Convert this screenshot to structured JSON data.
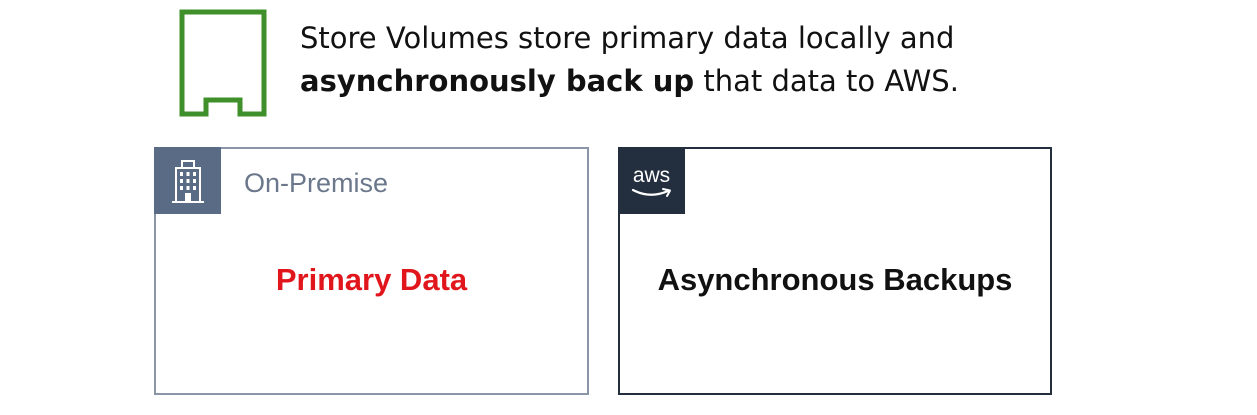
{
  "header": {
    "line1": "Store Volumes store primary data locally and",
    "line2_bold": "asynchronously back up",
    "line2_rest": " that data to AWS.",
    "icon": "storage-volume-icon"
  },
  "onprem_panel": {
    "label": "On-Premise",
    "content": "Primary Data",
    "icon": "building-icon"
  },
  "aws_panel": {
    "badge_text": "aws",
    "content": "Asynchronous Backups",
    "icon": "aws-logo-icon"
  },
  "colors": {
    "volume_icon": "#3f8f2a",
    "onprem_badge": "#5a6b86",
    "onprem_border": "#8a96a7",
    "aws_badge": "#232f3e",
    "primary_text": "#e0161c"
  }
}
